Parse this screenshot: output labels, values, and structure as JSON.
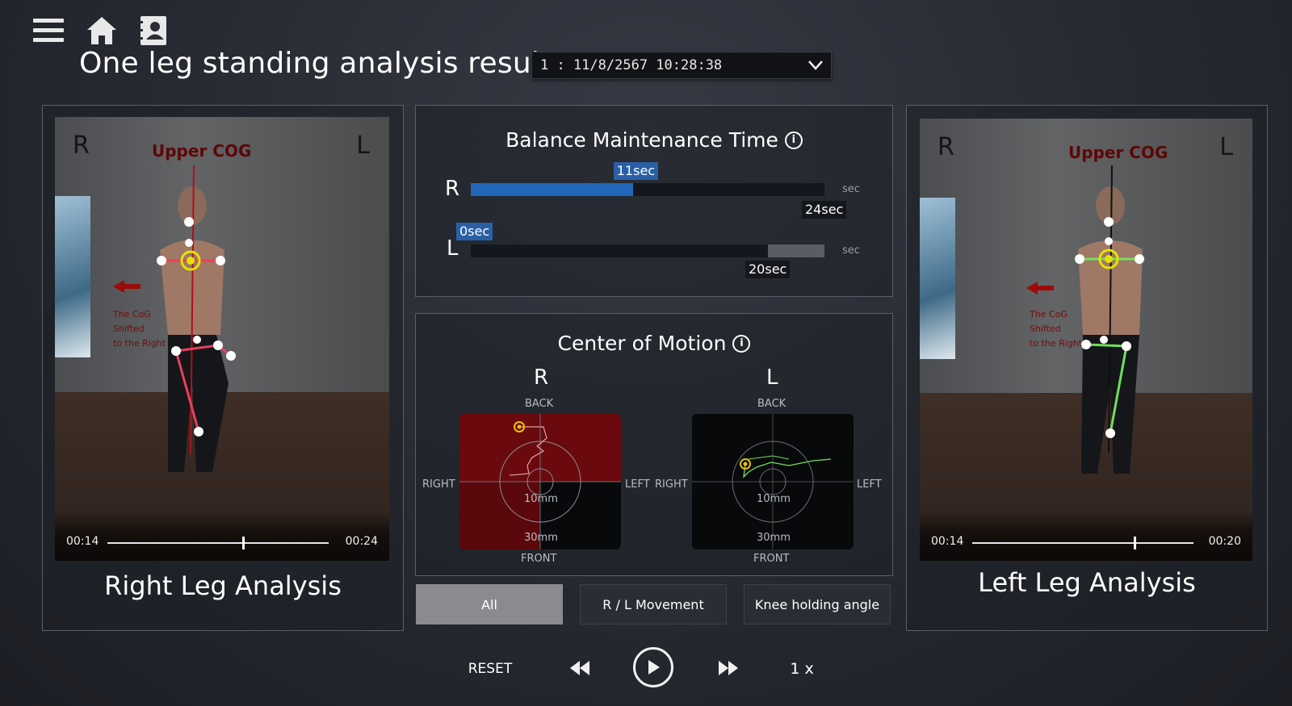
{
  "header": {
    "title": "One leg standing analysis result",
    "session": "1 : 11/8/2567 10:28:38",
    "icons": [
      "menu-icon",
      "home-icon",
      "contacts-icon"
    ]
  },
  "right_panel": {
    "label": "Right Leg Analysis",
    "side_left": "R",
    "side_right": "L",
    "cog_title": "Upper COG",
    "cog_note": [
      "The CoG",
      "Shifted",
      "to the Right"
    ],
    "time_current": "00:14",
    "time_total": "00:24",
    "progress": 0.61
  },
  "left_panel": {
    "label": "Left Leg Analysis",
    "side_left": "R",
    "side_right": "L",
    "cog_title": "Upper COG",
    "cog_note": [
      "The CoG",
      "Shifted",
      "to the Right"
    ],
    "time_current": "00:14",
    "time_total": "00:20",
    "progress": 0.73
  },
  "balance": {
    "title": "Balance Maintenance Time",
    "rows": [
      {
        "side": "R",
        "value_label": "11sec",
        "total_label": "24sec",
        "unit": "sec",
        "value": 11,
        "total": 24,
        "color": "#2266b8"
      },
      {
        "side": "L",
        "value_label": "0sec",
        "total_label": "20sec",
        "unit": "sec",
        "value": 0,
        "total": 20,
        "color": "#2266b8"
      }
    ]
  },
  "com": {
    "title": "Center of Motion",
    "right": {
      "side": "R",
      "back": "BACK",
      "front": "FRONT",
      "left": "LEFT",
      "right": "RIGHT",
      "inner": "10mm",
      "outer": "30mm"
    },
    "left": {
      "side": "L",
      "back": "BACK",
      "front": "FRONT",
      "left": "LEFT",
      "right": "RIGHT",
      "inner": "10mm",
      "outer": "30mm"
    }
  },
  "tabs": [
    {
      "label": "All",
      "active": true
    },
    {
      "label": "R / L Movement",
      "active": false
    },
    {
      "label": "Knee holding angle",
      "active": false
    }
  ],
  "controls": {
    "reset": "RESET",
    "speed": "1 x"
  },
  "colors": {
    "accent_blue": "#2266b8",
    "skeleton_red": "#e8405f",
    "skeleton_green": "#6ee05a",
    "cog_yellow": "#e6e200"
  }
}
